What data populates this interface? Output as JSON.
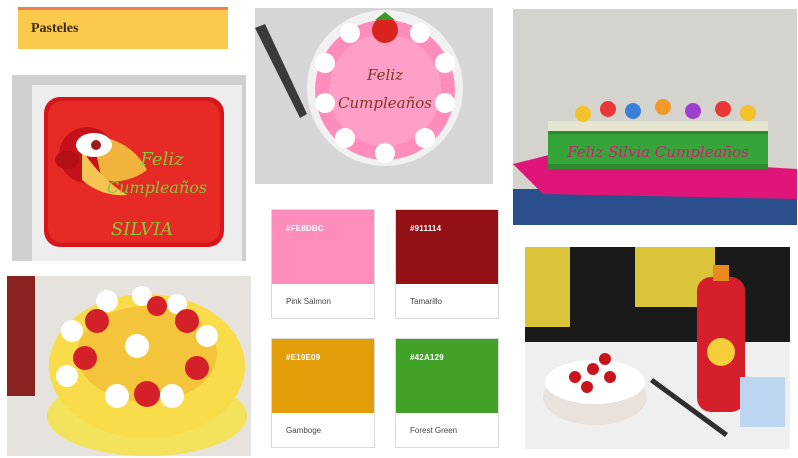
{
  "title": "Pasteles",
  "photos": {
    "red_cake": {
      "cake_text": [
        "Feliz",
        "Cumpleaños",
        "SILVIA"
      ]
    },
    "pink_cake": {
      "cake_text": [
        "Feliz",
        "Cumpleaños"
      ]
    },
    "long_cake": {
      "cake_text": "Feliz Silvia Cumpleaños"
    },
    "peach_cake": {},
    "party": {}
  },
  "palette": [
    {
      "hex": "#FE8DBC",
      "name": "Pink Salmon",
      "color": "#FE8DBC"
    },
    {
      "hex": "#911114",
      "name": "Tamarillo",
      "color": "#911114"
    },
    {
      "hex": "#E19E09",
      "name": "Gamboge",
      "color": "#E19E09"
    },
    {
      "hex": "#42A129",
      "name": "Forest Green",
      "color": "#42A129"
    }
  ]
}
